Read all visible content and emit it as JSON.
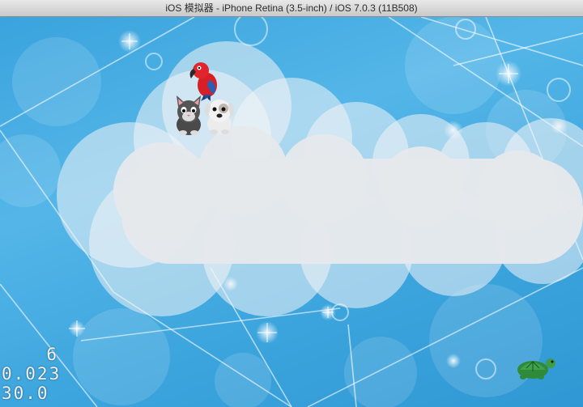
{
  "window": {
    "title": "iOS 模拟器 - iPhone Retina (3.5-inch) / iOS 7.0.3 (11B508)"
  },
  "game": {
    "sprites": [
      {
        "name": "parrot",
        "icon": "parrot-icon"
      },
      {
        "name": "cat",
        "icon": "cat-icon"
      },
      {
        "name": "dog",
        "icon": "dog-icon"
      },
      {
        "name": "turtle",
        "icon": "turtle-icon"
      }
    ],
    "stats": {
      "draw_calls": "6",
      "frame_time": "0.023",
      "fps": "30.0"
    }
  },
  "colors": {
    "sky": "#3aa3dd",
    "cloud": "#e6e9ec",
    "stat_text": "#f2f2f2"
  }
}
